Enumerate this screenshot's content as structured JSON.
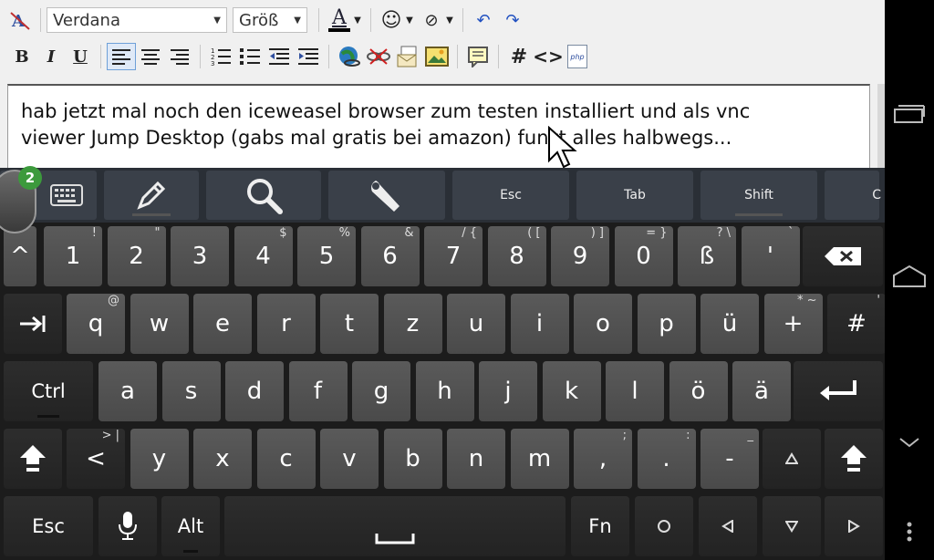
{
  "editor": {
    "font_combo": "Verdana",
    "size_combo": "Größ",
    "text_line1": "hab jetzt mal noch den iceweasel browser zum testen installiert und als vnc",
    "text_line2": "viewer Jump Desktop (gabs mal gratis bei amazon) funzt alles halbwegs..."
  },
  "toolbar": {
    "bold": "B",
    "italic": "I",
    "underline": "U",
    "font_color": "A",
    "hash": "#",
    "code": "<>",
    "php": "php"
  },
  "badge": {
    "count": "2"
  },
  "kbd_toolbar": {
    "esc": "Esc",
    "tab": "Tab",
    "shift": "Shift",
    "cut": "C"
  },
  "keyboard": {
    "row1": [
      {
        "main": "^",
        "sub": ""
      },
      {
        "main": "1",
        "sub": "!"
      },
      {
        "main": "2",
        "sub": "\""
      },
      {
        "main": "3",
        "sub": ""
      },
      {
        "main": "4",
        "sub": "$"
      },
      {
        "main": "5",
        "sub": "%"
      },
      {
        "main": "6",
        "sub": "&"
      },
      {
        "main": "7",
        "sub": "/ {"
      },
      {
        "main": "8",
        "sub": "( ["
      },
      {
        "main": "9",
        "sub": ") ]"
      },
      {
        "main": "0",
        "sub": "= }"
      },
      {
        "main": "ß",
        "sub": "? \\"
      },
      {
        "main": "'",
        "sub": "`"
      }
    ],
    "row2": [
      {
        "main": "q",
        "sub": "@"
      },
      {
        "main": "w",
        "sub": ""
      },
      {
        "main": "e",
        "sub": ""
      },
      {
        "main": "r",
        "sub": ""
      },
      {
        "main": "t",
        "sub": ""
      },
      {
        "main": "z",
        "sub": ""
      },
      {
        "main": "u",
        "sub": ""
      },
      {
        "main": "i",
        "sub": ""
      },
      {
        "main": "o",
        "sub": ""
      },
      {
        "main": "p",
        "sub": ""
      },
      {
        "main": "ü",
        "sub": ""
      },
      {
        "main": "+",
        "sub": "* ~"
      },
      {
        "main": "#",
        "sub": "'"
      }
    ],
    "row3": [
      {
        "main": "a",
        "sub": ""
      },
      {
        "main": "s",
        "sub": ""
      },
      {
        "main": "d",
        "sub": ""
      },
      {
        "main": "f",
        "sub": ""
      },
      {
        "main": "g",
        "sub": ""
      },
      {
        "main": "h",
        "sub": ""
      },
      {
        "main": "j",
        "sub": ""
      },
      {
        "main": "k",
        "sub": ""
      },
      {
        "main": "l",
        "sub": ""
      },
      {
        "main": "ö",
        "sub": ""
      },
      {
        "main": "ä",
        "sub": ""
      }
    ],
    "row4": [
      {
        "main": "<",
        "sub": "> |"
      },
      {
        "main": "y",
        "sub": ""
      },
      {
        "main": "x",
        "sub": ""
      },
      {
        "main": "c",
        "sub": ""
      },
      {
        "main": "v",
        "sub": ""
      },
      {
        "main": "b",
        "sub": ""
      },
      {
        "main": "n",
        "sub": ""
      },
      {
        "main": "m",
        "sub": ""
      },
      {
        "main": ",",
        "sub": ";"
      },
      {
        "main": ".",
        "sub": ":"
      },
      {
        "main": "-",
        "sub": "_"
      }
    ],
    "ctrl": "Ctrl",
    "esc": "Esc",
    "alt": "Alt",
    "fn": "Fn"
  }
}
